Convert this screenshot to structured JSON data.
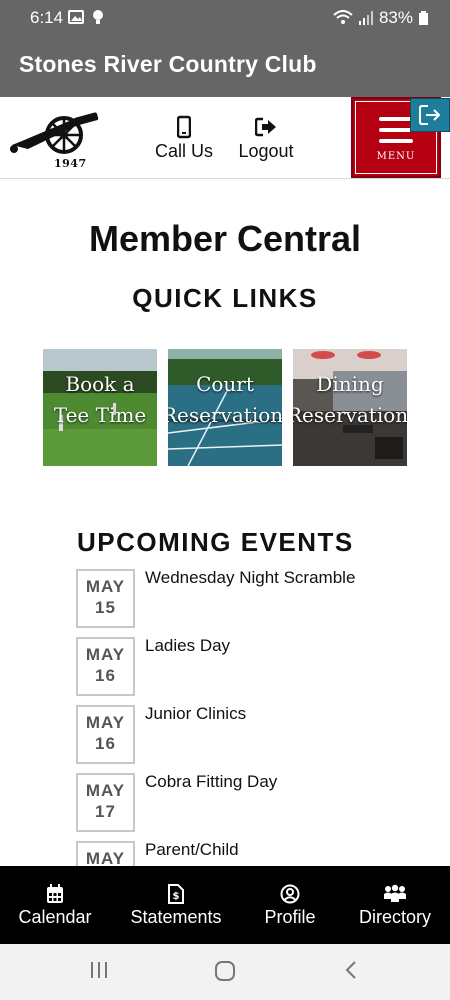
{
  "status_bar": {
    "time": "6:14",
    "battery": "83%"
  },
  "app": {
    "title": "Stones River Country Club"
  },
  "header": {
    "logo_year": "1947",
    "call_label": "Call Us",
    "logout_label": "Logout",
    "menu_label": "MENU"
  },
  "main": {
    "title": "Member Central",
    "quick_links_heading": "QUICK LINKS",
    "quick_links": [
      {
        "line1": "Book a",
        "line2": "Tee Time"
      },
      {
        "line1": "Court",
        "line2": "Reservations"
      },
      {
        "line1": "Dining",
        "line2": "Reservations"
      }
    ],
    "events_heading": "UPCOMING EVENTS",
    "events": [
      {
        "month": "MAY",
        "day": "15",
        "title": "Wednesday Night Scramble"
      },
      {
        "month": "MAY",
        "day": "16",
        "title": "Ladies Day"
      },
      {
        "month": "MAY",
        "day": "16",
        "title": "Junior Clinics"
      },
      {
        "month": "MAY",
        "day": "17",
        "title": "Cobra Fitting Day"
      },
      {
        "month": "MAY",
        "day": "",
        "title": "Parent/Child"
      }
    ]
  },
  "bottom_nav": [
    {
      "label": "Calendar",
      "icon": "calendar-icon"
    },
    {
      "label": "Statements",
      "icon": "statement-icon"
    },
    {
      "label": "Profile",
      "icon": "profile-icon"
    },
    {
      "label": "Directory",
      "icon": "directory-icon"
    }
  ],
  "colors": {
    "title_bar": "#666666",
    "menu_red": "#b50012",
    "exit_tab": "#1f7d9c",
    "nav_bg": "#000000"
  }
}
